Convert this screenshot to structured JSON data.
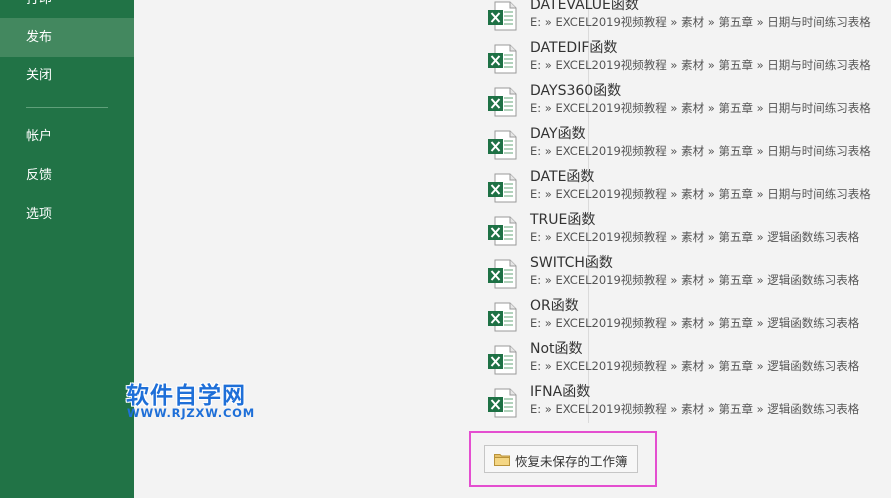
{
  "sidebar": {
    "items": [
      {
        "id": "print",
        "label": "打印"
      },
      {
        "id": "publish",
        "label": "发布"
      },
      {
        "id": "close",
        "label": "关闭"
      },
      {
        "id": "account",
        "label": "帐户"
      },
      {
        "id": "feedback",
        "label": "反馈"
      },
      {
        "id": "options",
        "label": "选项"
      }
    ],
    "active": "发布"
  },
  "recent_files": [
    {
      "name": "DATEVALUE函数",
      "path": "E: » EXCEL2019视频教程 » 素材 » 第五章 » 日期与时间练习表格",
      "icon": "excel-file-icon"
    },
    {
      "name": "DATEDIF函数",
      "path": "E: » EXCEL2019视频教程 » 素材 » 第五章 » 日期与时间练习表格",
      "icon": "excel-file-icon"
    },
    {
      "name": "DAYS360函数",
      "path": "E: » EXCEL2019视频教程 » 素材 » 第五章 » 日期与时间练习表格",
      "icon": "excel-file-icon"
    },
    {
      "name": "DAY函数",
      "path": "E: » EXCEL2019视频教程 » 素材 » 第五章 » 日期与时间练习表格",
      "icon": "excel-file-icon"
    },
    {
      "name": "DATE函数",
      "path": "E: » EXCEL2019视频教程 » 素材 » 第五章 » 日期与时间练习表格",
      "icon": "excel-file-icon"
    },
    {
      "name": "TRUE函数",
      "path": "E: » EXCEL2019视频教程 » 素材 » 第五章 » 逻辑函数练习表格",
      "icon": "excel-file-icon"
    },
    {
      "name": "SWITCH函数",
      "path": "E: » EXCEL2019视频教程 » 素材 » 第五章 » 逻辑函数练习表格",
      "icon": "excel-file-icon"
    },
    {
      "name": "OR函数",
      "path": "E: » EXCEL2019视频教程 » 素材 » 第五章 » 逻辑函数练习表格",
      "icon": "excel-file-icon"
    },
    {
      "name": "Not函数",
      "path": "E: » EXCEL2019视频教程 » 素材 » 第五章 » 逻辑函数练习表格",
      "icon": "excel-file-icon"
    },
    {
      "name": "IFNA函数",
      "path": "E: » EXCEL2019视频教程 » 素材 » 第五章 » 逻辑函数练习表格",
      "icon": "excel-file-icon"
    }
  ],
  "recover_button": {
    "label": "恢复未保存的工作簿",
    "icon": "folder-icon"
  },
  "watermark": {
    "title": "软件自学网",
    "url": "WWW.RJZXW.COM"
  },
  "colors": {
    "sidebar": "#217346",
    "sidebar_active": "#43885f",
    "excel_green": "#1e7145",
    "highlight": "#e44ed0",
    "watermark": "#1e6fd8"
  }
}
